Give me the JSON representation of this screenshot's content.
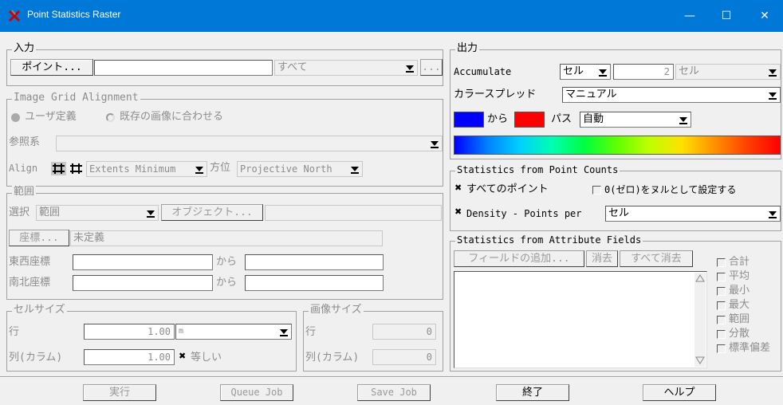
{
  "window": {
    "title": "Point Statistics Raster",
    "minimize": "—",
    "maximize": "☐",
    "close": "✕"
  },
  "input": {
    "legend": "入力",
    "points_button": "ポイント...",
    "points_value": "",
    "points_filter": "すべて",
    "points_more": "..."
  },
  "grid_alignment": {
    "legend": "Image Grid Alignment",
    "user_defined": "ユーザ定義",
    "match_existing": "既存の画像に合わせる",
    "refsys_label": "参照系",
    "refsys_value": "",
    "align_label": "Align",
    "align_value": "Extents Minimum",
    "orientation_label": "方位",
    "orientation_value": "Projective North"
  },
  "extent": {
    "legend": "範囲",
    "select_label": "選択",
    "select_value": "範囲",
    "object_button": "オブジェクト...",
    "object_value": "",
    "coords_button": "座標...",
    "coords_value": "未定義",
    "ew_label": "東西座標",
    "ns_label": "南北座標",
    "from1": "から",
    "from2": "から"
  },
  "cell_size": {
    "legend": "セルサイズ",
    "row_label": "行",
    "row_value": "1.00",
    "unit_value": "m",
    "col_label": "列(カラム)",
    "col_value": "1.00",
    "equal_label": "等しい"
  },
  "image_size": {
    "legend": "画像サイズ",
    "row_label": "行",
    "row_value": "0",
    "col_label": "列(カラム)",
    "col_value": "0"
  },
  "output": {
    "legend": "出力",
    "accumulate_label": "Accumulate",
    "accumulate_value": "セル",
    "count_value": "2",
    "count_unit": "セル",
    "spread_label": "カラースプレッド",
    "spread_value": "マニュアル",
    "from_label": "から",
    "path_label": "パス",
    "path_value": "自動",
    "color_from": "#0000ff",
    "color_to": "#ff0000"
  },
  "point_counts": {
    "legend": "Statistics from Point Counts",
    "all_points": "すべてのポイント",
    "zero_null": "0(ゼロ)をヌルとして設定する",
    "density_label": "Density - Points per",
    "density_value": "セル"
  },
  "attr_fields": {
    "legend": "Statistics from Attribute Fields",
    "add_field": "フィールドの追加...",
    "remove": "消去",
    "remove_all": "すべて消去",
    "stats": [
      "合計",
      "平均",
      "最小",
      "最大",
      "範囲",
      "分散",
      "標準偏差"
    ]
  },
  "footer": {
    "run": "実行",
    "queue_job": "Queue Job",
    "save_job": "Save Job",
    "exit": "終了",
    "help": "ヘルプ"
  }
}
